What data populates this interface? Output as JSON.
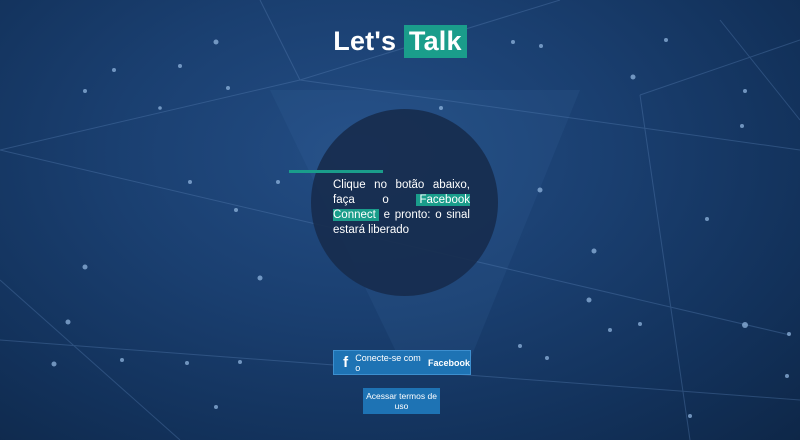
{
  "header": {
    "title_prefix": "Let's",
    "title_highlight": "Talk"
  },
  "intro": {
    "line_part1": "Clique no botão abaixo, faça o",
    "highlight": "Facebook Connect",
    "line_part2": "e pronto: o sinal estará liberado"
  },
  "facebook_button": {
    "icon": "facebook-f-icon",
    "label_prefix": "Conecte-se com o",
    "label_brand": "Facebook"
  },
  "terms_button": {
    "label": "Acessar termos de uso"
  },
  "colors": {
    "accent": "#1a9d8b",
    "button": "#1e73b4",
    "background": "#1a3f70"
  }
}
